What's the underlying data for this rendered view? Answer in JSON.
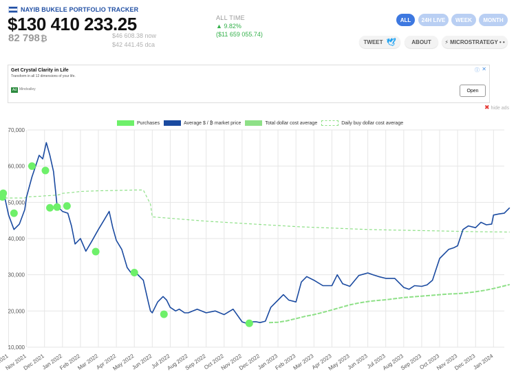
{
  "header": {
    "brand": "NAYIB BUKELE PORTFOLIO TRACKER",
    "value_usd": "$130 410 233.25",
    "value_btc": "82 798",
    "btc_symbol": "₿",
    "now_value": "$46 608.38 now",
    "dca_value": "$42 441.45 dca"
  },
  "all_time": {
    "label": "ALL TIME",
    "percent": "▲ 9.82%",
    "usd": "($11 659 055.74)",
    "color": "#33b04a"
  },
  "range_buttons": [
    {
      "label": "ALL",
      "active": true
    },
    {
      "label": "24H LIVE",
      "active": false
    },
    {
      "label": "WEEK",
      "active": false
    },
    {
      "label": "MONTH",
      "active": false
    }
  ],
  "actions": {
    "tweet": "TWEET",
    "about": "ABOUT",
    "microstrategy": "⚡ MICROSTRATEGY • •"
  },
  "ad": {
    "title": "Get Crystal Clarity in Life",
    "subtitle": "Transform in all 12 dimensions of your life.",
    "badge": "Ad",
    "advertiser": "Mindvalley",
    "open": "Open",
    "info": "ⓘ",
    "close": "✕"
  },
  "hide_ads": {
    "icon": "✖",
    "label": "hide ads"
  },
  "legend": [
    {
      "label": "Purchases",
      "swatch": "purchases"
    },
    {
      "label": "Average $ / ₿ market price",
      "swatch": "average"
    },
    {
      "label": "Total dollar cost average",
      "swatch": "total"
    },
    {
      "label": "Daily buy dollar cost average",
      "swatch": "daily"
    }
  ],
  "colors": {
    "price": "#1a4aa0",
    "purchase": "#6ef06a",
    "dca": "#8ee087",
    "active_button": "#3d78e0",
    "inactive_button": "#b9cff3"
  },
  "chart_data": {
    "type": "line",
    "xlabel": "",
    "ylabel": "",
    "ylim": [
      10000,
      70000
    ],
    "y_ticks": [
      "10,000",
      "20,000",
      "30,000",
      "40,000",
      "50,000",
      "60,000",
      "70,000"
    ],
    "x_ticks": [
      "Oct 2021",
      "Nov 2021",
      "Dec 2021",
      "Jan 2022",
      "Feb 2022",
      "Mar 2022",
      "Apr 2022",
      "May 2022",
      "Jun 2022",
      "Jul 2022",
      "Aug 2022",
      "Sep 2022",
      "Oct 2022",
      "Nov 2022",
      "Dec 2022",
      "Jan 2023",
      "Feb 2023",
      "Mar 2023",
      "Apr 2023",
      "May 2023",
      "Jun 2023",
      "Jul 2023",
      "Aug 2023",
      "Sep 2023",
      "Oct 2023",
      "Nov 2023",
      "Dec 2023",
      "Jan 2024"
    ],
    "grid": true,
    "legend_position": "top",
    "series": [
      {
        "name": "Average $ / ₿ market price",
        "style": "solid",
        "x": [
          -0.2,
          0,
          0.3,
          0.6,
          0.9,
          1.0,
          1.3,
          1.5,
          1.7,
          1.9,
          2.1,
          2.3,
          2.5,
          2.7,
          3.0,
          3.3,
          3.5,
          3.7,
          4.0,
          4.3,
          4.6,
          5.0,
          5.3,
          5.6,
          5.8,
          6.0,
          6.3,
          6.6,
          6.9,
          7.1,
          7.5,
          7.8,
          7.9,
          8.0,
          8.3,
          8.6,
          8.8,
          9.0,
          9.3,
          9.5,
          9.8,
          10.0,
          10.5,
          11.0,
          11.5,
          12.0,
          12.5,
          13.0,
          13.3,
          13.6,
          13.8,
          14.0,
          14.3,
          14.6,
          15.0,
          15.3,
          15.6,
          16.0,
          16.3,
          16.6,
          17.0,
          17.5,
          18.0,
          18.3,
          18.6,
          19.0,
          19.5,
          20.0,
          20.3,
          20.6,
          21.0,
          21.5,
          22.0,
          22.3,
          22.6,
          23.0,
          23.3,
          23.6,
          24.0,
          24.5,
          24.8,
          25.0,
          25.3,
          25.6,
          26.0,
          26.3,
          26.6,
          26.9,
          27.0,
          27.3,
          27.6,
          27.9
        ],
        "y": [
          51000,
          46500,
          42500,
          44000,
          48000,
          51500,
          57000,
          60000,
          63000,
          62000,
          66500,
          63000,
          58500,
          49000,
          47500,
          47000,
          43500,
          38500,
          40000,
          36500,
          39000,
          42500,
          45000,
          47500,
          43000,
          39500,
          37000,
          32000,
          30000,
          30500,
          28500,
          22000,
          20000,
          19500,
          22500,
          24000,
          23000,
          21000,
          20000,
          20500,
          19500,
          19500,
          20500,
          19500,
          20000,
          19000,
          20500,
          17000,
          16500,
          17000,
          17000,
          16800,
          17200,
          21000,
          23000,
          24500,
          23000,
          22500,
          28000,
          29500,
          28500,
          27000,
          27000,
          30000,
          27500,
          26800,
          29800,
          30500,
          30000,
          29500,
          29000,
          29000,
          26500,
          26000,
          27000,
          26800,
          27200,
          28500,
          34500,
          37000,
          37500,
          38000,
          42500,
          43500,
          43000,
          44500,
          43800,
          44000,
          46500,
          46800,
          47000,
          48500
        ]
      },
      {
        "name": "Total dollar cost average",
        "style": "solid",
        "x": [
          14.5,
          15.0,
          15.5,
          16.0,
          16.5,
          17.0,
          17.5,
          18.0,
          18.5,
          19.0,
          19.5,
          20.0,
          20.5,
          21.0,
          21.5,
          22.0,
          22.5,
          23.0,
          23.5,
          24.0,
          24.5,
          25.0,
          25.5,
          26.0,
          26.5,
          27.0,
          27.5,
          27.9
        ],
        "y": [
          16800,
          16900,
          17300,
          17900,
          18500,
          19000,
          19600,
          20300,
          21000,
          21700,
          22200,
          22600,
          22900,
          23100,
          23400,
          23700,
          23900,
          24100,
          24300,
          24500,
          24700,
          24800,
          25000,
          25300,
          25700,
          26200,
          26800,
          27300
        ]
      },
      {
        "name": "Daily buy dollar cost average",
        "style": "dashed",
        "x": [
          -0.2,
          0.5,
          0.9,
          1.0,
          1.8,
          2.0,
          2.7,
          2.9,
          3.0,
          3.5,
          4.0,
          5.0,
          6.0,
          7.0,
          7.5,
          7.9,
          8.0,
          8.5,
          9.0,
          10.0,
          11.0,
          12.0,
          13.0,
          14.0,
          15.0,
          16.0,
          17.0,
          18.0,
          19.0,
          20.0,
          21.0,
          22.0,
          23.0,
          24.0,
          25.0,
          26.0,
          27.0,
          27.9
        ],
        "y": [
          51200,
          51200,
          51200,
          51500,
          51700,
          51800,
          52000,
          52200,
          52500,
          52700,
          53000,
          53200,
          53300,
          53400,
          53400,
          49500,
          46000,
          45800,
          45600,
          45200,
          44800,
          44500,
          44200,
          43900,
          43600,
          43300,
          43100,
          42900,
          42700,
          42500,
          42400,
          42300,
          42200,
          42100,
          42000,
          41900,
          41850,
          41800
        ]
      },
      {
        "name": "Purchases",
        "style": "points",
        "x": [
          -0.35,
          -0.3,
          0.3,
          1.3,
          2.05,
          2.3,
          2.7,
          3.25,
          4.85,
          7.0,
          8.65,
          13.4
        ],
        "y": [
          51500,
          52500,
          47000,
          60000,
          58800,
          48500,
          48700,
          49000,
          36400,
          30600,
          19100,
          16600
        ]
      }
    ]
  }
}
